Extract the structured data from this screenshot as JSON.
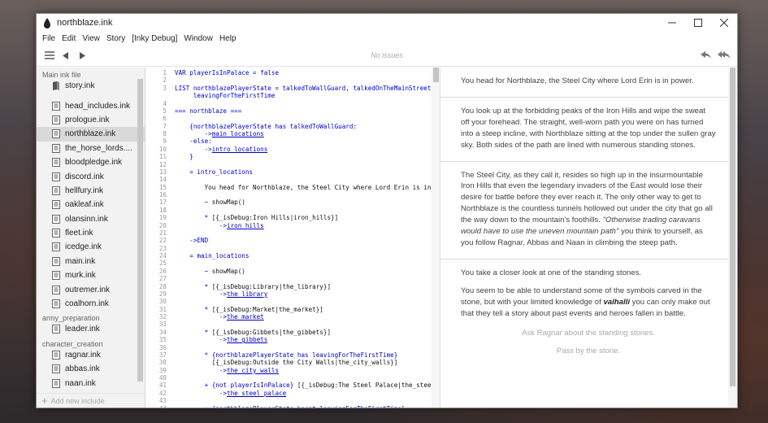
{
  "window": {
    "title": "northblaze.ink"
  },
  "menu": [
    "File",
    "Edit",
    "View",
    "Story",
    "[Inky Debug]",
    "Window",
    "Help"
  ],
  "toolbar": {
    "status": "No issues"
  },
  "sidebar": {
    "sections": [
      {
        "label": "Main ink file",
        "items": [
          {
            "label": "story.ink",
            "icon": "book-icon",
            "active": false
          }
        ]
      },
      {
        "label": "",
        "items": [
          {
            "label": "head_includes.ink"
          },
          {
            "label": "prologue.ink"
          },
          {
            "label": "northblaze.ink",
            "active": true
          },
          {
            "label": "the_horse_lords...."
          },
          {
            "label": "bloodpledge.ink"
          },
          {
            "label": "discord.ink"
          },
          {
            "label": "hellfury.ink"
          },
          {
            "label": "oakleaf.ink"
          },
          {
            "label": "olansinn.ink"
          },
          {
            "label": "fleet.ink"
          },
          {
            "label": "icedge.ink"
          },
          {
            "label": "main.ink"
          },
          {
            "label": "murk.ink"
          },
          {
            "label": "outremer.ink"
          },
          {
            "label": "coalhorn.ink"
          }
        ]
      },
      {
        "label": "army_preparation",
        "items": [
          {
            "label": "leader.ink"
          }
        ]
      },
      {
        "label": "character_creation",
        "items": [
          {
            "label": "ragnar.ink"
          },
          {
            "label": "abbas.ink"
          },
          {
            "label": "naan.ink"
          }
        ]
      }
    ],
    "add_include": "Add new include"
  },
  "editor": {
    "lines": [
      {
        "n": "1",
        "segs": [
          [
            "kw",
            "VAR playerIsInPalace = false"
          ]
        ]
      },
      {
        "n": "2",
        "segs": []
      },
      {
        "n": "3",
        "segs": [
          [
            "kw",
            "LIST northblazePlayerState = talkedToWallGuard, talkedOnTheMainStreet, "
          ]
        ]
      },
      {
        "n": "",
        "segs": [
          [
            "kw",
            "     leavingForTheFirstTime"
          ]
        ]
      },
      {
        "n": "4",
        "segs": []
      },
      {
        "n": "5",
        "segs": [
          [
            "kw",
            "=== northblaze ==="
          ]
        ]
      },
      {
        "n": "6",
        "segs": []
      },
      {
        "n": "7",
        "segs": [
          [
            "kw",
            "    {northblazePlayerState has talkedToWallGuard:"
          ]
        ]
      },
      {
        "n": "8",
        "segs": [
          [
            "kw",
            "        ->"
          ],
          [
            "link",
            "main_locations"
          ]
        ]
      },
      {
        "n": "9",
        "segs": [
          [
            "kw",
            "    -else:"
          ]
        ]
      },
      {
        "n": "10",
        "segs": [
          [
            "kw",
            "        ->"
          ],
          [
            "link",
            "intro_locations"
          ]
        ]
      },
      {
        "n": "11",
        "segs": [
          [
            "kw",
            "    }"
          ]
        ]
      },
      {
        "n": "12",
        "segs": []
      },
      {
        "n": "13",
        "segs": [
          [
            "kw",
            "    = intro_locations"
          ]
        ]
      },
      {
        "n": "14",
        "segs": []
      },
      {
        "n": "15",
        "segs": [
          [
            "plain",
            "        You head for Northblaze, the Steel City where Lord Erin is in p"
          ]
        ]
      },
      {
        "n": "16",
        "segs": []
      },
      {
        "n": "17",
        "segs": [
          [
            "kw",
            "        ~ "
          ],
          [
            "plain",
            "showMap()"
          ]
        ]
      },
      {
        "n": "18",
        "segs": []
      },
      {
        "n": "19",
        "segs": [
          [
            "kw",
            "        * "
          ],
          [
            "plain",
            "[{_isDebug:Iron Hills|iron_hills}]"
          ]
        ]
      },
      {
        "n": "20",
        "segs": [
          [
            "kw",
            "            ->"
          ],
          [
            "link",
            "iron_hills"
          ]
        ]
      },
      {
        "n": "21",
        "segs": []
      },
      {
        "n": "22",
        "segs": [
          [
            "kw",
            "    ->END"
          ]
        ]
      },
      {
        "n": "23",
        "segs": []
      },
      {
        "n": "24",
        "segs": [
          [
            "kw",
            "    = main_locations"
          ]
        ]
      },
      {
        "n": "25",
        "segs": []
      },
      {
        "n": "26",
        "segs": [
          [
            "kw",
            "        ~ "
          ],
          [
            "plain",
            "showMap()"
          ]
        ]
      },
      {
        "n": "27",
        "segs": []
      },
      {
        "n": "28",
        "segs": [
          [
            "kw",
            "        * "
          ],
          [
            "plain",
            "[{_isDebug:Library|the_library}]"
          ]
        ]
      },
      {
        "n": "29",
        "segs": [
          [
            "kw",
            "            ->"
          ],
          [
            "link",
            "the_library"
          ]
        ]
      },
      {
        "n": "30",
        "segs": []
      },
      {
        "n": "31",
        "segs": [
          [
            "kw",
            "        * "
          ],
          [
            "plain",
            "[{_isDebug:Market|the_market}]"
          ]
        ]
      },
      {
        "n": "32",
        "segs": [
          [
            "kw",
            "            ->"
          ],
          [
            "link",
            "the_market"
          ]
        ]
      },
      {
        "n": "33",
        "segs": []
      },
      {
        "n": "34",
        "segs": [
          [
            "kw",
            "        * "
          ],
          [
            "plain",
            "[{_isDebug:Gibbets|the_gibbets}]"
          ]
        ]
      },
      {
        "n": "35",
        "segs": [
          [
            "kw",
            "            ->"
          ],
          [
            "link",
            "the_gibbets"
          ]
        ]
      },
      {
        "n": "36",
        "segs": []
      },
      {
        "n": "37",
        "segs": [
          [
            "kw",
            "        * {northblazePlayerState has leavingForTheFirstTime}"
          ]
        ]
      },
      {
        "n": "38",
        "segs": [
          [
            "kw",
            "          "
          ],
          [
            "plain",
            "[{_isDebug:Outside the City Walls|the_city_walls}]"
          ]
        ]
      },
      {
        "n": "39",
        "segs": [
          [
            "kw",
            "            ->"
          ],
          [
            "link",
            "the_city_walls"
          ]
        ]
      },
      {
        "n": "40",
        "segs": []
      },
      {
        "n": "41",
        "segs": [
          [
            "kw",
            "        + {not playerIsInPalace} "
          ],
          [
            "plain",
            "[{_isDebug:The Steel Palace|the_steel_"
          ]
        ]
      },
      {
        "n": "42",
        "segs": [
          [
            "kw",
            "            ->"
          ],
          [
            "link",
            "the_steel_palace"
          ]
        ]
      },
      {
        "n": "43",
        "segs": []
      },
      {
        "n": "44",
        "segs": [
          [
            "kw",
            "        + {northblazePlayerState hasnt leavingForTheFirstTime}"
          ]
        ]
      },
      {
        "n": "45",
        "segs": [
          [
            "kw",
            "          "
          ],
          [
            "plain",
            "[{_isDebug:Leave the City|leave_northblaze}]"
          ]
        ]
      }
    ]
  },
  "player": {
    "blocks": [
      {
        "paras": [
          [
            [
              "t",
              "You head for Northblaze, the Steel City where Lord Erin is in power."
            ]
          ]
        ]
      },
      {
        "paras": [
          [
            [
              "t",
              "You look up at the forbidding peaks of the Iron Hills and wipe the sweat off your forehead. The straight, well-worn path you were on has turned into a steep incline, with Northblaze sitting at the top under the sullen gray sky. Both sides of the path are lined with numerous standing stones."
            ]
          ]
        ]
      },
      {
        "paras": [
          [
            [
              "t",
              "The Steel City, as they call it, resides so high up in the insurmountable Iron Hills that even the legendary invaders of the East would lose their desire for battle before they ever reach it. The only other way to get to Northblaze is the countless tunnels hollowed out under the city that go all the way down to the mountain's foothills. "
            ],
            [
              "i",
              "\"Otherwise trading caravans would have to use the uneven mountain path\""
            ],
            [
              "t",
              " you think to yourself, as you follow Ragnar, Abbas and Naan in climbing the steep path."
            ]
          ]
        ]
      },
      {
        "paras": [
          [
            [
              "t",
              "You take a closer look at one of the standing stones."
            ]
          ],
          [
            [
              "t",
              "You seem to be able to understand some of the symbols carved in the stone, but with your limited knowledge of "
            ],
            [
              "b",
              "valhalli"
            ],
            [
              "t",
              " you can only make out that they tell a story about past events and heroes fallen in battle."
            ]
          ]
        ],
        "choices": [
          "Ask Ragnar about the standing stones.",
          "Pass by the stone."
        ]
      }
    ]
  },
  "colors": {
    "keyword": "#0000cc",
    "active_file_bg": "#d9d9d9"
  }
}
